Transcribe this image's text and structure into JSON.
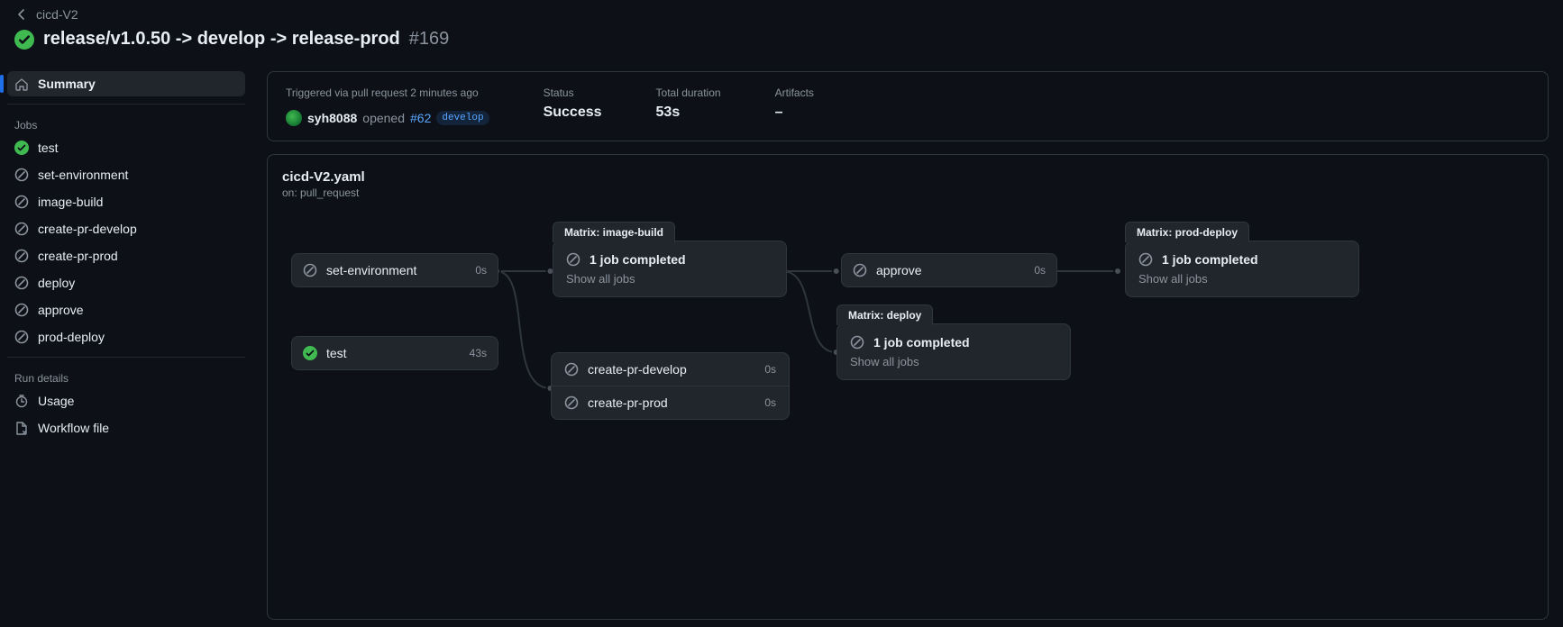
{
  "breadcrumb": {
    "back_label": "cicd-V2"
  },
  "title": {
    "text": "release/v1.0.50 -> develop -> release-prod",
    "run_number": "#169"
  },
  "sidebar": {
    "summary": "Summary",
    "jobs_heading": "Jobs",
    "jobs": [
      {
        "label": "test",
        "status": "success"
      },
      {
        "label": "set-environment",
        "status": "skipped"
      },
      {
        "label": "image-build",
        "status": "skipped"
      },
      {
        "label": "create-pr-develop",
        "status": "skipped"
      },
      {
        "label": "create-pr-prod",
        "status": "skipped"
      },
      {
        "label": "deploy",
        "status": "skipped"
      },
      {
        "label": "approve",
        "status": "skipped"
      },
      {
        "label": "prod-deploy",
        "status": "skipped"
      }
    ],
    "details_heading": "Run details",
    "details": [
      {
        "label": "Usage",
        "icon": "stopwatch"
      },
      {
        "label": "Workflow file",
        "icon": "file"
      }
    ]
  },
  "meta": {
    "trigger_text": "Triggered via pull request 2 minutes ago",
    "actor": "syh8088",
    "action_text": "opened",
    "pr_number": "#62",
    "branch": "develop",
    "status_label": "Status",
    "status_value": "Success",
    "duration_label": "Total duration",
    "duration_value": "53s",
    "artifacts_label": "Artifacts",
    "artifacts_value": "–"
  },
  "graph": {
    "file": "cicd-V2.yaml",
    "on_label": "on: pull_request",
    "nodes": {
      "set_env": {
        "label": "set-environment",
        "time": "0s",
        "status": "skipped"
      },
      "test": {
        "label": "test",
        "time": "43s",
        "status": "success"
      },
      "image_build": {
        "tab": "Matrix: image-build",
        "summary": "1 job completed",
        "show_all": "Show all jobs",
        "status": "skipped"
      },
      "create_pr_develop": {
        "label": "create-pr-develop",
        "time": "0s",
        "status": "skipped"
      },
      "create_pr_prod": {
        "label": "create-pr-prod",
        "time": "0s",
        "status": "skipped"
      },
      "approve": {
        "label": "approve",
        "time": "0s",
        "status": "skipped"
      },
      "deploy": {
        "tab": "Matrix: deploy",
        "summary": "1 job completed",
        "show_all": "Show all jobs",
        "status": "skipped"
      },
      "prod_deploy": {
        "tab": "Matrix: prod-deploy",
        "summary": "1 job completed",
        "show_all": "Show all jobs",
        "status": "skipped"
      }
    }
  }
}
